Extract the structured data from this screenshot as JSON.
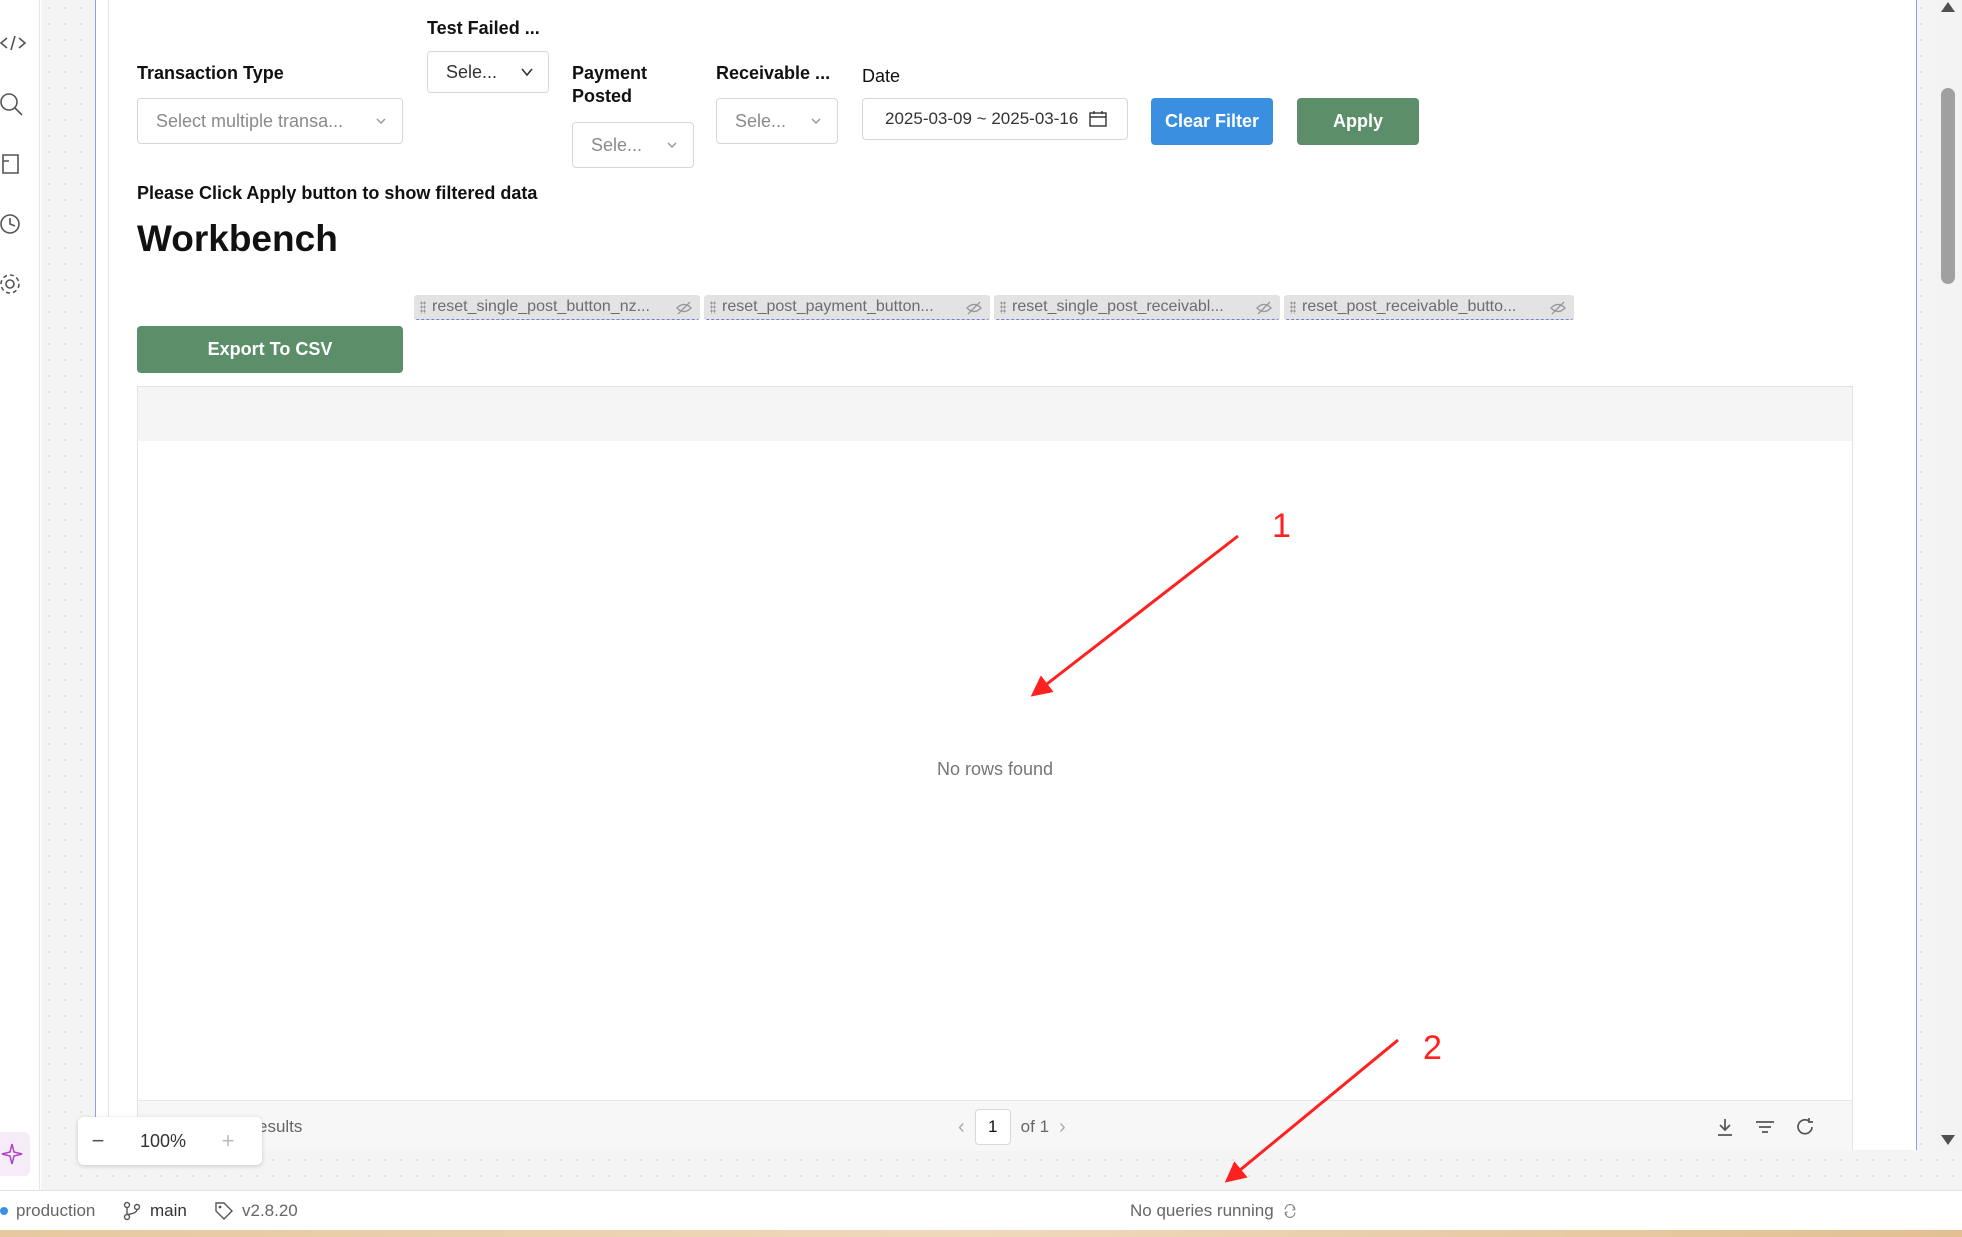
{
  "filters": {
    "transaction_type": {
      "label": "Transaction Type",
      "placeholder": "Select multiple transa..."
    },
    "test_failed": {
      "label": "Test Failed ...",
      "placeholder": "Sele..."
    },
    "payment_posted": {
      "label_line1": "Payment",
      "label_line2": "Posted",
      "placeholder": "Sele..."
    },
    "receivable": {
      "label": "Receivable ...",
      "placeholder": "Sele..."
    },
    "date": {
      "label": "Date",
      "value": "2025-03-09 ~ 2025-03-16"
    },
    "clear_filter_label": "Clear Filter",
    "apply_label": "Apply"
  },
  "hint_text": "Please Click Apply button to show filtered data",
  "page_title": "Workbench",
  "hidden_components": [
    "reset_single_post_button_nz...",
    "reset_post_payment_button...",
    "reset_single_post_receivabl...",
    "reset_post_receivable_butto..."
  ],
  "export_label": "Export To CSV",
  "table": {
    "empty_text": "No rows found",
    "results_text": "esults",
    "page_number": "1",
    "page_of": "of 1"
  },
  "zoom": {
    "minus": "−",
    "level": "100%",
    "plus": "+"
  },
  "status_bar": {
    "environment": "production",
    "branch": "main",
    "version": "v2.8.20",
    "queries": "No queries running"
  },
  "annotations": {
    "label_1": "1",
    "label_2": "2",
    "color": "#ff2020"
  },
  "colors": {
    "accent_blue": "#3b8fe1",
    "accent_green": "#5c8e6a",
    "frame_border": "#8da2e6"
  }
}
